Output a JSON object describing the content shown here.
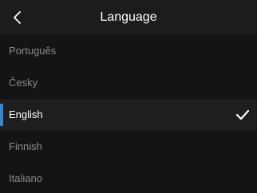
{
  "header": {
    "title": "Language",
    "back_icon": "chevron-left-icon"
  },
  "languages": [
    {
      "label": "Português",
      "selected": false
    },
    {
      "label": "Česky",
      "selected": false
    },
    {
      "label": "English",
      "selected": true
    },
    {
      "label": "Finnish",
      "selected": false
    },
    {
      "label": "Italiano",
      "selected": false
    }
  ],
  "selected_icon": "check-icon",
  "colors": {
    "background": "#141414",
    "header_background": "#1c1c1c",
    "accent": "#3d86c6",
    "text_active": "#ffffff",
    "text_inactive": "#8a8a8a"
  }
}
